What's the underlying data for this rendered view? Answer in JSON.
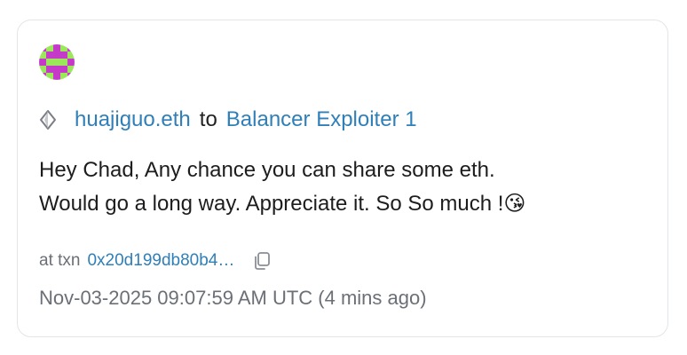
{
  "sender": {
    "name": "huajiguo.eth"
  },
  "route": {
    "connector": "to"
  },
  "recipient": {
    "name": "Balancer Exploiter 1"
  },
  "message": {
    "line1": "Hey Chad, Any chance you can share some eth.",
    "line2": "Would go a long way. Appreciate it. So So much !😘"
  },
  "transaction": {
    "label": "at txn",
    "hash_display": "0x20d199db80b4…"
  },
  "timestamp": {
    "text": "Nov-03-2025 09:07:59 AM UTC (4 mins ago)"
  },
  "icons": {
    "avatar": "identicon-avatar",
    "chain": "ethereum-icon",
    "copy": "copy-icon"
  },
  "colors": {
    "link": "#2f7fb8",
    "muted": "#6b6f76",
    "avatar_primary": "#c63ac9",
    "avatar_secondary": "#9be95a"
  }
}
